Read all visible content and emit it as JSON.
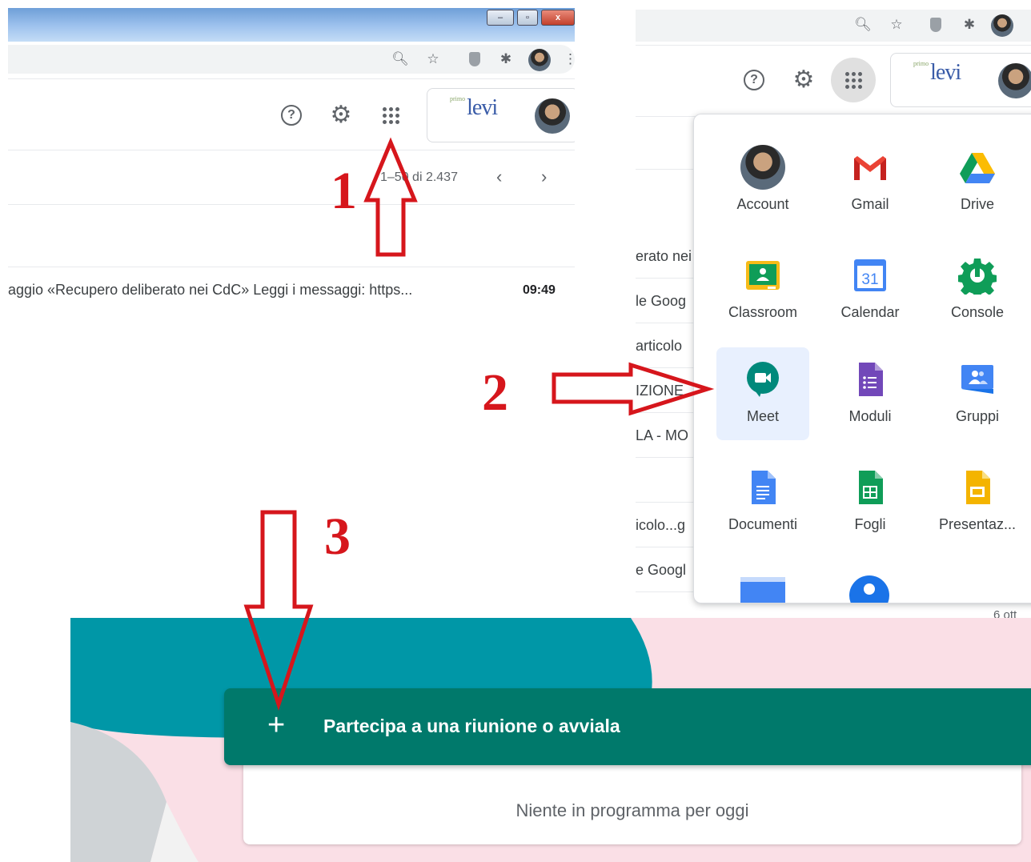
{
  "panel1": {
    "window_controls": {
      "minimize": "–",
      "restore": "▫",
      "close": "x"
    },
    "header": {
      "logo_small": "primo",
      "logo_text": "levi"
    },
    "pagination": {
      "range": "1–50 di 2.437"
    },
    "email_row": {
      "snippet": "aggio «Recupero deliberato nei CdC» Leggi i messaggi: https...",
      "time": "09:49"
    }
  },
  "panel2": {
    "header": {
      "logo_small": "primo",
      "logo_text": "levi"
    },
    "mail_fragments": [
      "erato nei",
      "le Goog",
      "articolo",
      "IZIONE",
      "LA - MO",
      "",
      "icolo...g",
      "e Googl"
    ],
    "bottom_date": "6 ott",
    "apps": [
      {
        "label": "Account",
        "icon": "account-avatar-icon"
      },
      {
        "label": "Gmail",
        "icon": "gmail-icon"
      },
      {
        "label": "Drive",
        "icon": "drive-icon"
      },
      {
        "label": "Classroom",
        "icon": "classroom-icon"
      },
      {
        "label": "Calendar",
        "icon": "calendar-icon",
        "icon_text": "31"
      },
      {
        "label": "Console",
        "icon": "console-icon"
      },
      {
        "label": "Meet",
        "icon": "meet-icon",
        "selected": true
      },
      {
        "label": "Moduli",
        "icon": "forms-icon"
      },
      {
        "label": "Gruppi",
        "icon": "groups-icon"
      },
      {
        "label": "Documenti",
        "icon": "docs-icon"
      },
      {
        "label": "Fogli",
        "icon": "sheets-icon"
      },
      {
        "label": "Presentaz...",
        "icon": "slides-icon"
      }
    ],
    "colors": {
      "meet_selected_bg": "#e8f0fe"
    }
  },
  "panel3": {
    "join_button": {
      "icon": "+",
      "label": "Partecipa a una riunione o avviala"
    },
    "empty_state": "Niente in programma per oggi",
    "colors": {
      "join_bg": "#00796b",
      "background": "#fadfe6",
      "teal_shape": "#0097a7"
    }
  },
  "annotations": {
    "step1": "1",
    "step2": "2",
    "step3": "3",
    "arrow_color": "#d6161c"
  }
}
